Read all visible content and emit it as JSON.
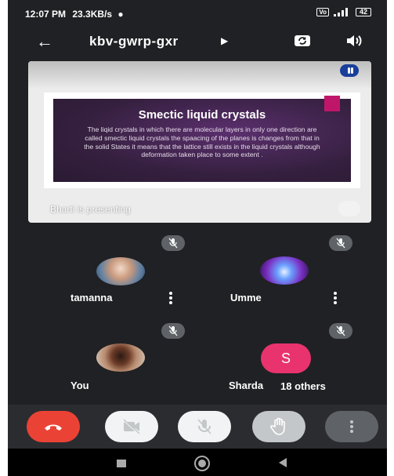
{
  "status_bar": {
    "time": "12:07 PM",
    "speed": "23.3KB/s",
    "vowifi": "VoWiFi",
    "battery": "42"
  },
  "top_bar": {
    "meeting_code": "kbv-gwrp-gxr",
    "back_icon": "arrow-left-icon",
    "switch_camera_icon": "switch-camera-icon",
    "speaker_icon": "speaker-icon"
  },
  "presentation": {
    "slide_title": "Smectic liquid crystals",
    "slide_body": "The liqid crystals in which there are molecular layers in only one direction  are called smectic liquid  crystals the spaacing of the planes is changes from  that  in  the  solid States it means that the lattice still exists in the liquid crystals although  deformation taken place to some extent .",
    "presenting_label": "Bharti is presenting",
    "accent_color": "#c0166a"
  },
  "participants": [
    {
      "name": "tamanna",
      "muted": true
    },
    {
      "name": "Umme",
      "muted": true
    },
    {
      "name": "You",
      "muted": true
    },
    {
      "name": "Sharda",
      "initial": "S",
      "muted": true,
      "avatar_color": "#e8336e"
    }
  ],
  "others_label": "18 others",
  "controls": {
    "end_call_color": "#ea4335",
    "end_call_icon": "phone-hangup-icon",
    "camera_icon": "camera-off-icon",
    "mic_icon": "mic-off-icon",
    "raise_hand_icon": "hand-icon",
    "more_icon": "more-vertical-icon"
  }
}
